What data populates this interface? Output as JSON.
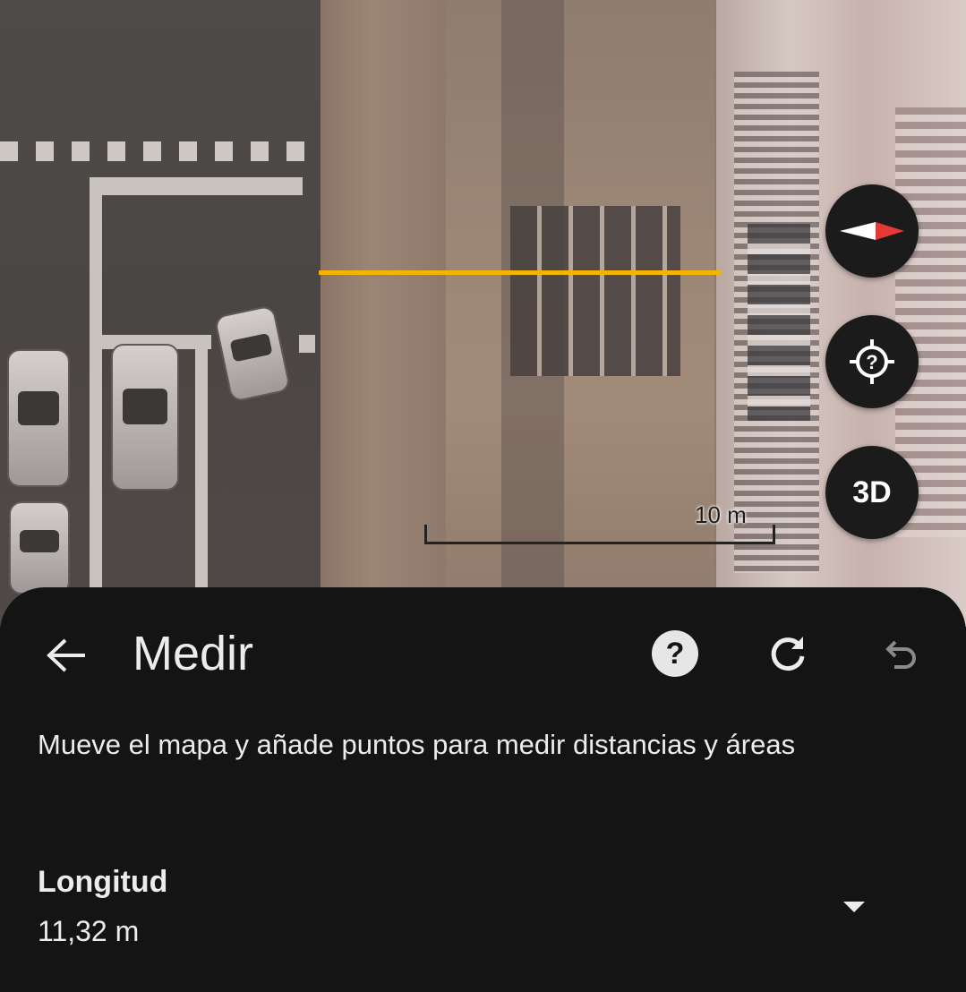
{
  "map": {
    "scale_label": "10 m",
    "measure_line_color": "#f4b400",
    "controls": {
      "compass_icon": "compass-icon",
      "locate_icon": "locate-icon",
      "view_3d_label": "3D"
    }
  },
  "sheet": {
    "title": "Medir",
    "back_icon": "arrow-left-icon",
    "help_glyph": "?",
    "reset_icon": "refresh-icon",
    "undo_icon": "undo-icon",
    "description": "Mueve el mapa y añade puntos para medir distancias y áreas",
    "length_label": "Longitud",
    "length_value": "11,32 m",
    "expand_icon": "caret-down-icon"
  },
  "colors": {
    "sheet_bg": "#141414",
    "text": "#ececec",
    "accent_line": "#f4b400",
    "compass_red": "#e53935"
  }
}
